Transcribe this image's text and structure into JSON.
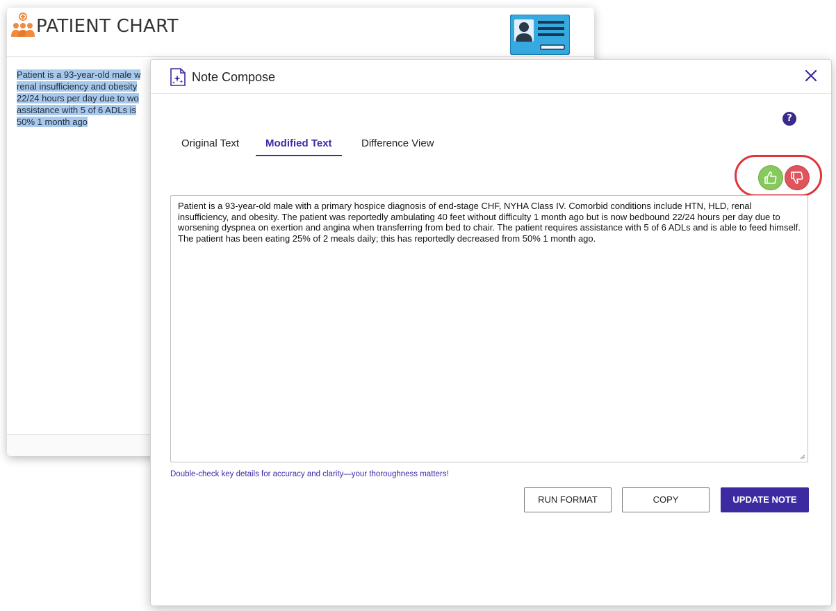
{
  "chart_window": {
    "title": "PATIENT CHART",
    "body_lines": [
      "Patient is a 93-year-old male w",
      "renal insufficiency and obesity",
      "22/24 hours per day due to wo",
      "assistance with 5 of 6 ADLs is",
      "50% 1 month ago"
    ]
  },
  "modal": {
    "title": "Note Compose",
    "help_label": "?",
    "tabs": [
      {
        "label": "Original Text"
      },
      {
        "label": "Modified Text",
        "active": true
      },
      {
        "label": "Difference View"
      }
    ],
    "note_text": "Patient is a 93-year-old male with a primary hospice diagnosis of end-stage CHF, NYHA Class IV. Comorbid conditions include HTN, HLD, renal insufficiency, and obesity. The patient was reportedly ambulating 40 feet without difficulty 1 month ago but is now bedbound 22/24 hours per day due to worsening dyspnea on exertion and angina when transferring from bed to chair. The patient requires assistance with 5 of 6 ADLs and is able to feed himself. The patient has been eating 25% of 2 meals daily; this has reportedly decreased from 50% 1 month ago.",
    "reminder": "Double-check key details for accuracy and clarity—your thoroughness matters!",
    "buttons": {
      "run_format": "RUN FORMAT",
      "copy": "COPY",
      "update_note": "UPDATE NOTE"
    }
  },
  "colors": {
    "accent": "#3b2aa0",
    "thumb_up": "#86c95c",
    "thumb_down": "#e0545c",
    "highlight_ring": "#e0333a",
    "selection": "#a8c9ec"
  },
  "icons": [
    "patients-group-icon",
    "id-card-icon",
    "compose-sparkle-icon",
    "close-icon",
    "help-icon",
    "thumbs-up-icon",
    "thumbs-down-icon"
  ]
}
